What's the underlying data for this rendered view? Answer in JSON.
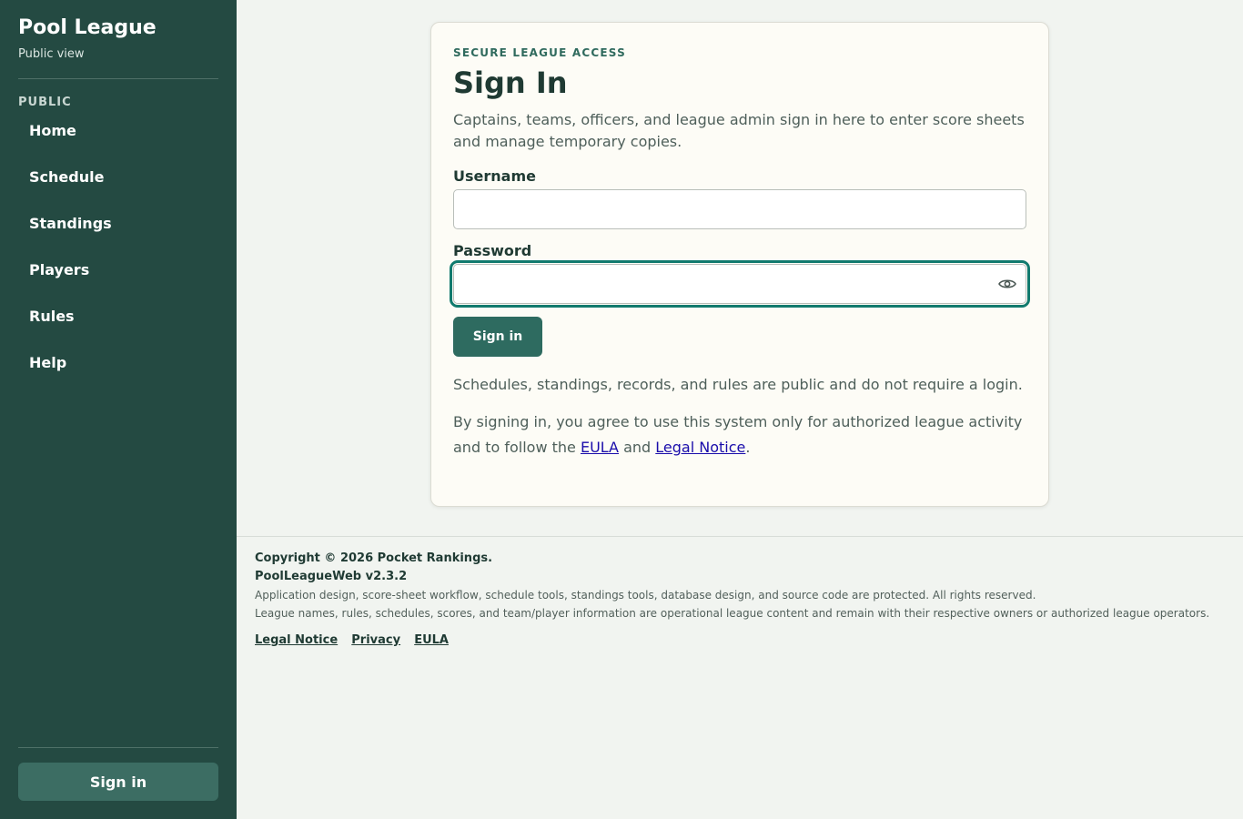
{
  "sidebar": {
    "title": "Pool League",
    "subtitle": "Public view",
    "section_label": "PUBLIC",
    "items": [
      {
        "label": "Home"
      },
      {
        "label": "Schedule"
      },
      {
        "label": "Standings"
      },
      {
        "label": "Players"
      },
      {
        "label": "Rules"
      },
      {
        "label": "Help"
      }
    ],
    "signin_label": "Sign in"
  },
  "card": {
    "eyebrow": "SECURE LEAGUE ACCESS",
    "title": "Sign In",
    "intro": "Captains, teams, officers, and league admin sign in here to enter score sheets and manage temporary copies.",
    "username_label": "Username",
    "username_value": "",
    "password_label": "Password",
    "password_value": "",
    "password_toggle_icon": "eye-icon",
    "submit_label": "Sign in",
    "public_note": "Schedules, standings, records, and rules are public and do not require a login.",
    "agree_prefix": "By signing in, you agree to use this system only for authorized league activity and to follow the ",
    "eula_link": "EULA",
    "agree_and": " and ",
    "legal_link": "Legal Notice",
    "agree_suffix": "."
  },
  "footer": {
    "copyright": "Copyright © 2026 Pocket Rankings.",
    "version": "PoolLeagueWeb v2.3.2",
    "line1": "Application design, score-sheet workflow, schedule tools, standings tools, database design, and source code are protected. All rights reserved.",
    "line2": "League names, rules, schedules, scores, and team/player information are operational league content and remain with their respective owners or authorized league operators.",
    "links": [
      {
        "label": "Legal Notice"
      },
      {
        "label": "Privacy"
      },
      {
        "label": "EULA"
      }
    ]
  },
  "colors": {
    "sidebar_bg": "#244a42",
    "accent": "#2e6b60",
    "focus_ring": "#117a6e",
    "page_bg": "#f1f4f0",
    "card_bg": "#fdfcf6"
  }
}
